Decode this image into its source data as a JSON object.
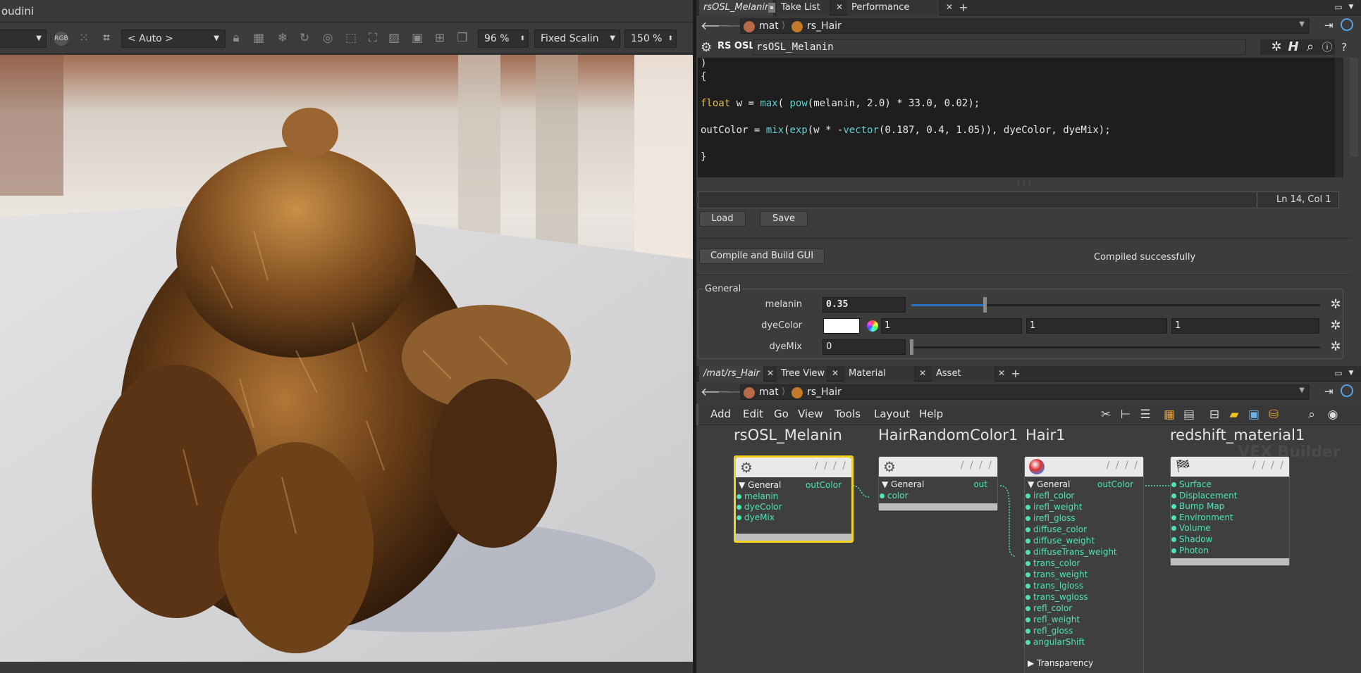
{
  "window": {
    "title_fragment": "oudini"
  },
  "viewer": {
    "camera_dropdown": "< Auto >",
    "zoom": "96 %",
    "scaling_mode": "Fixed Scalin",
    "scale_percent": "150 %",
    "rgb_badge": "RGB"
  },
  "top_pane": {
    "tabs": [
      {
        "label": "rsOSL_Melanin"
      },
      {
        "label": "Take List"
      },
      {
        "label": "Performance Monitor"
      }
    ],
    "path": [
      "mat",
      "rs_Hair"
    ],
    "node_type": "RS OSL",
    "node_name": "rsOSL_Melanin",
    "code_lines": [
      ")",
      "{",
      "",
      "float w = max( pow(melanin, 2.0) * 33.0, 0.02);",
      "",
      "outColor = mix(exp(w * -vector(0.187, 0.4, 1.05)), dyeColor, dyeMix);",
      "",
      "}"
    ],
    "cursor_position": "Ln 14, Col 1",
    "load_label": "Load",
    "save_label": "Save",
    "compile_label": "Compile and Build GUI",
    "compile_status": "Compiled successfully",
    "folder_label": "General",
    "params": {
      "melanin_label": "melanin",
      "melanin_value": "0.35",
      "melanin_fraction": 0.35,
      "dyecolor_label": "dyeColor",
      "dyecolor_r": "1",
      "dyecolor_g": "1",
      "dyecolor_b": "1",
      "dyemix_label": "dyeMix",
      "dyemix_value": "0"
    }
  },
  "bottom_pane": {
    "tabs": [
      {
        "label": "/mat/rs_Hair"
      },
      {
        "label": "Tree View"
      },
      {
        "label": "Material Palette"
      },
      {
        "label": "Asset Browser"
      }
    ],
    "path": [
      "mat",
      "rs_Hair"
    ],
    "menu": [
      "Add",
      "Edit",
      "Go",
      "View",
      "Tools",
      "Layout",
      "Help"
    ],
    "watermark": "VEX Builder",
    "nodes": {
      "melanin": {
        "name": "rsOSL_Melanin",
        "section": "General",
        "output": "outColor",
        "inputs": [
          "melanin",
          "dyeColor",
          "dyeMix"
        ]
      },
      "randcolor": {
        "name": "HairRandomColor1",
        "section": "General",
        "output": "out",
        "inputs": [
          "color"
        ]
      },
      "hair": {
        "name": "Hair1",
        "section": "General",
        "output": "outColor",
        "inputs": [
          "irefl_color",
          "irefl_weight",
          "irefl_gloss",
          "diffuse_color",
          "diffuse_weight",
          "diffuseTrans_weight",
          "trans_color",
          "trans_weight",
          "trans_lgloss",
          "trans_wgloss",
          "refl_color",
          "refl_weight",
          "refl_gloss",
          "angularShift"
        ],
        "collapsed_section": "Transparency"
      },
      "material": {
        "name": "redshift_material1",
        "inputs": [
          "Surface",
          "Displacement",
          "Bump Map",
          "Environment",
          "Volume",
          "Shadow",
          "Photon"
        ]
      }
    }
  },
  "colors": {
    "selected_node": "#f2d21b",
    "port": "#4fe3b8",
    "keyword": "#e7c04b",
    "function": "#5fd0d0",
    "slider": "#2a6fbf"
  }
}
